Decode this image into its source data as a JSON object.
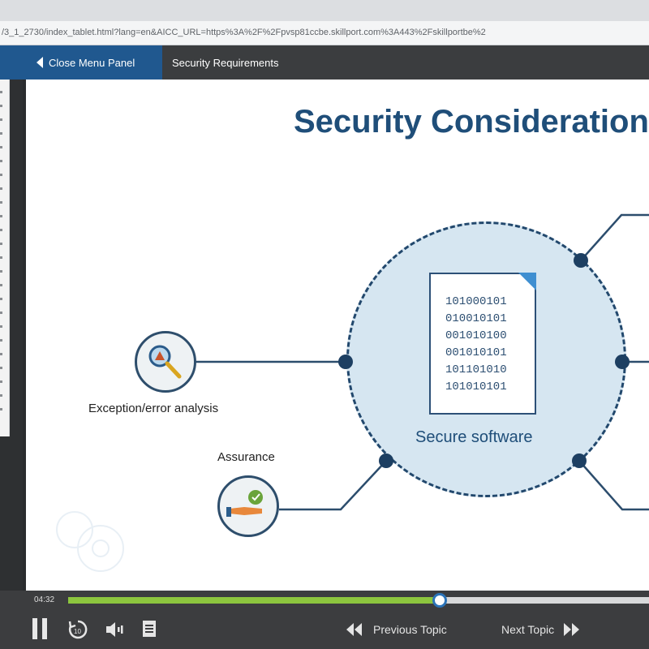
{
  "browser": {
    "url": "/3_1_2730/index_tablet.html?lang=en&AICC_URL=https%3A%2F%2Fpvsp81ccbe.skillport.com%3A443%2Fskillportbe%2"
  },
  "toolbar": {
    "close_menu_label": "Close Menu Panel",
    "topic_title": "Security Requirements"
  },
  "slide": {
    "title": "Security Considerations",
    "center_label": "Secure software",
    "binary_lines": [
      "101000101",
      "010010101",
      "001010100",
      "001010101",
      "101101010",
      "101010101"
    ],
    "items": {
      "exception": "Exception/error analysis",
      "assurance": "Assurance"
    }
  },
  "player": {
    "elapsed": "04:32",
    "progress": 0.64,
    "previous_label": "Previous Topic",
    "next_label": "Next Topic"
  },
  "colors": {
    "accent_blue": "#20588f",
    "title_navy": "#1f4e79",
    "progress_green": "#8cc63e",
    "circle_fill": "#d6e6f1"
  }
}
